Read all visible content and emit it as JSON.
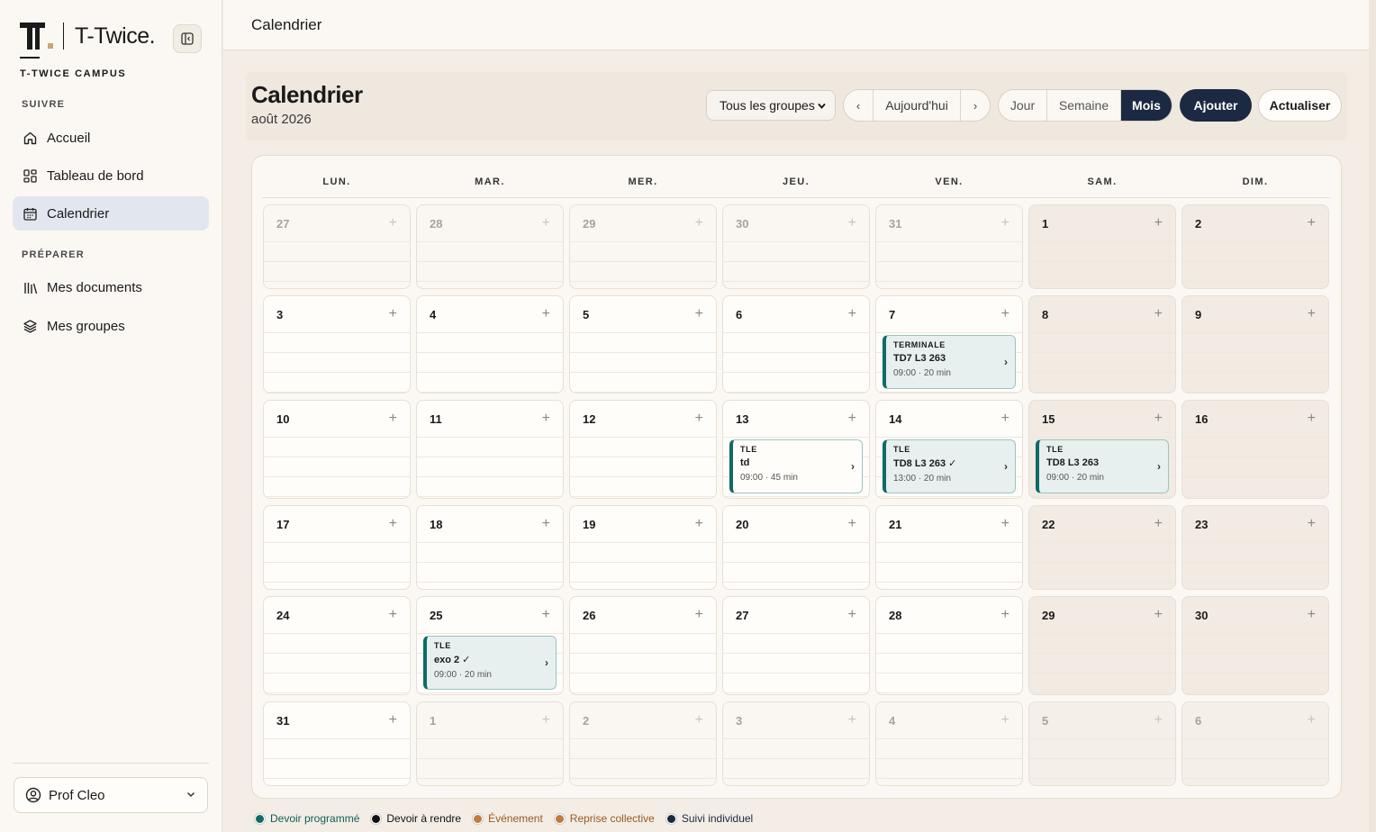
{
  "app": {
    "brand": "T-Twice.",
    "campus": "T-TWICE CAMPUS"
  },
  "sidebar": {
    "section_suivre": "SUIVRE",
    "section_preparer": "PRÉPARER",
    "items": [
      {
        "label": "Accueil",
        "icon": "home-icon",
        "active": false
      },
      {
        "label": "Tableau de bord",
        "icon": "dashboard-icon",
        "active": false
      },
      {
        "label": "Calendrier",
        "icon": "calendar-icon",
        "active": true
      },
      {
        "label": "Mes documents",
        "icon": "library-icon",
        "active": false
      },
      {
        "label": "Mes groupes",
        "icon": "layers-icon",
        "active": false
      }
    ],
    "user": "Prof Cleo"
  },
  "topbar": {
    "title": "Calendrier"
  },
  "header": {
    "title": "Calendrier",
    "subtitle": "août 2026",
    "group_select": "Tous les groupes",
    "prev": "‹",
    "today": "Aujourd'hui",
    "next": "›",
    "views": [
      "Jour",
      "Semaine",
      "Mois"
    ],
    "active_view": "Mois",
    "add": "Ajouter",
    "refresh": "Actualiser"
  },
  "calendar": {
    "weekdays": [
      "LUN.",
      "MAR.",
      "MER.",
      "JEU.",
      "VEN.",
      "SAM.",
      "DIM."
    ],
    "weeks": [
      [
        {
          "d": "27",
          "out": true
        },
        {
          "d": "28",
          "out": true
        },
        {
          "d": "29",
          "out": true
        },
        {
          "d": "30",
          "out": true
        },
        {
          "d": "31",
          "out": true
        },
        {
          "d": "1",
          "out": false
        },
        {
          "d": "2",
          "out": false
        }
      ],
      [
        {
          "d": "3",
          "out": false
        },
        {
          "d": "4",
          "out": false
        },
        {
          "d": "5",
          "out": false
        },
        {
          "d": "6",
          "out": false
        },
        {
          "d": "7",
          "out": false
        },
        {
          "d": "8",
          "out": false
        },
        {
          "d": "9",
          "out": false
        }
      ],
      [
        {
          "d": "10",
          "out": false
        },
        {
          "d": "11",
          "out": false
        },
        {
          "d": "12",
          "out": false
        },
        {
          "d": "13",
          "out": false
        },
        {
          "d": "14",
          "out": false
        },
        {
          "d": "15",
          "out": false
        },
        {
          "d": "16",
          "out": false
        }
      ],
      [
        {
          "d": "17",
          "out": false
        },
        {
          "d": "18",
          "out": false
        },
        {
          "d": "19",
          "out": false
        },
        {
          "d": "20",
          "out": false
        },
        {
          "d": "21",
          "out": false
        },
        {
          "d": "22",
          "out": false
        },
        {
          "d": "23",
          "out": false
        }
      ],
      [
        {
          "d": "24",
          "out": false
        },
        {
          "d": "25",
          "out": false
        },
        {
          "d": "26",
          "out": false
        },
        {
          "d": "27",
          "out": false
        },
        {
          "d": "28",
          "out": false
        },
        {
          "d": "29",
          "out": false
        },
        {
          "d": "30",
          "out": false
        }
      ],
      [
        {
          "d": "31",
          "out": false
        },
        {
          "d": "1",
          "out": true
        },
        {
          "d": "2",
          "out": true
        },
        {
          "d": "3",
          "out": true
        },
        {
          "d": "4",
          "out": true
        },
        {
          "d": "5",
          "out": true
        },
        {
          "d": "6",
          "out": true
        }
      ]
    ],
    "events": [
      {
        "week": 1,
        "day": 4,
        "tag": "TERMINALE",
        "title": "TD7 L3 263",
        "meta": "09:00 · 20 min",
        "style": "tinted"
      },
      {
        "week": 2,
        "day": 3,
        "tag": "TLE",
        "title": "td",
        "meta": "09:00 · 45 min",
        "style": "white"
      },
      {
        "week": 2,
        "day": 4,
        "tag": "TLE",
        "title": "TD8 L3 263 ✓",
        "meta": "13:00 · 20 min",
        "style": "tinted"
      },
      {
        "week": 2,
        "day": 5,
        "tag": "TLE",
        "title": "TD8 L3 263",
        "meta": "09:00 · 20 min",
        "style": "tinted"
      },
      {
        "week": 4,
        "day": 1,
        "tag": "TLE",
        "title": "exo 2 ✓",
        "meta": "09:00 · 20 min",
        "style": "tinted"
      }
    ]
  },
  "legend": [
    {
      "label": "Devoir programmé",
      "color": "#0f6b66",
      "text_color": "#0f5f5a"
    },
    {
      "label": "Devoir à rendre",
      "color": "#111111",
      "text_color": "#111111"
    },
    {
      "label": "Événement",
      "color": "#c47a3a",
      "text_color": "#9a5a22"
    },
    {
      "label": "Reprise collective",
      "color": "#c47a3a",
      "text_color": "#9a5a22"
    },
    {
      "label": "Suivi individuel",
      "color": "#1b2942",
      "text_color": "#1b2942"
    }
  ]
}
